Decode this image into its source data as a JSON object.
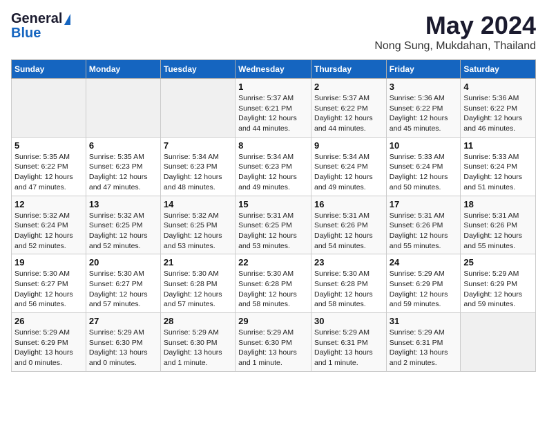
{
  "header": {
    "logo_line1": "General",
    "logo_line2": "Blue",
    "title": "May 2024",
    "subtitle": "Nong Sung, Mukdahan, Thailand"
  },
  "columns": [
    "Sunday",
    "Monday",
    "Tuesday",
    "Wednesday",
    "Thursday",
    "Friday",
    "Saturday"
  ],
  "weeks": [
    [
      {
        "day": "",
        "info": ""
      },
      {
        "day": "",
        "info": ""
      },
      {
        "day": "",
        "info": ""
      },
      {
        "day": "1",
        "info": "Sunrise: 5:37 AM\nSunset: 6:21 PM\nDaylight: 12 hours and 44 minutes."
      },
      {
        "day": "2",
        "info": "Sunrise: 5:37 AM\nSunset: 6:22 PM\nDaylight: 12 hours and 44 minutes."
      },
      {
        "day": "3",
        "info": "Sunrise: 5:36 AM\nSunset: 6:22 PM\nDaylight: 12 hours and 45 minutes."
      },
      {
        "day": "4",
        "info": "Sunrise: 5:36 AM\nSunset: 6:22 PM\nDaylight: 12 hours and 46 minutes."
      }
    ],
    [
      {
        "day": "5",
        "info": "Sunrise: 5:35 AM\nSunset: 6:22 PM\nDaylight: 12 hours and 47 minutes."
      },
      {
        "day": "6",
        "info": "Sunrise: 5:35 AM\nSunset: 6:23 PM\nDaylight: 12 hours and 47 minutes."
      },
      {
        "day": "7",
        "info": "Sunrise: 5:34 AM\nSunset: 6:23 PM\nDaylight: 12 hours and 48 minutes."
      },
      {
        "day": "8",
        "info": "Sunrise: 5:34 AM\nSunset: 6:23 PM\nDaylight: 12 hours and 49 minutes."
      },
      {
        "day": "9",
        "info": "Sunrise: 5:34 AM\nSunset: 6:24 PM\nDaylight: 12 hours and 49 minutes."
      },
      {
        "day": "10",
        "info": "Sunrise: 5:33 AM\nSunset: 6:24 PM\nDaylight: 12 hours and 50 minutes."
      },
      {
        "day": "11",
        "info": "Sunrise: 5:33 AM\nSunset: 6:24 PM\nDaylight: 12 hours and 51 minutes."
      }
    ],
    [
      {
        "day": "12",
        "info": "Sunrise: 5:32 AM\nSunset: 6:24 PM\nDaylight: 12 hours and 52 minutes."
      },
      {
        "day": "13",
        "info": "Sunrise: 5:32 AM\nSunset: 6:25 PM\nDaylight: 12 hours and 52 minutes."
      },
      {
        "day": "14",
        "info": "Sunrise: 5:32 AM\nSunset: 6:25 PM\nDaylight: 12 hours and 53 minutes."
      },
      {
        "day": "15",
        "info": "Sunrise: 5:31 AM\nSunset: 6:25 PM\nDaylight: 12 hours and 53 minutes."
      },
      {
        "day": "16",
        "info": "Sunrise: 5:31 AM\nSunset: 6:26 PM\nDaylight: 12 hours and 54 minutes."
      },
      {
        "day": "17",
        "info": "Sunrise: 5:31 AM\nSunset: 6:26 PM\nDaylight: 12 hours and 55 minutes."
      },
      {
        "day": "18",
        "info": "Sunrise: 5:31 AM\nSunset: 6:26 PM\nDaylight: 12 hours and 55 minutes."
      }
    ],
    [
      {
        "day": "19",
        "info": "Sunrise: 5:30 AM\nSunset: 6:27 PM\nDaylight: 12 hours and 56 minutes."
      },
      {
        "day": "20",
        "info": "Sunrise: 5:30 AM\nSunset: 6:27 PM\nDaylight: 12 hours and 57 minutes."
      },
      {
        "day": "21",
        "info": "Sunrise: 5:30 AM\nSunset: 6:28 PM\nDaylight: 12 hours and 57 minutes."
      },
      {
        "day": "22",
        "info": "Sunrise: 5:30 AM\nSunset: 6:28 PM\nDaylight: 12 hours and 58 minutes."
      },
      {
        "day": "23",
        "info": "Sunrise: 5:30 AM\nSunset: 6:28 PM\nDaylight: 12 hours and 58 minutes."
      },
      {
        "day": "24",
        "info": "Sunrise: 5:29 AM\nSunset: 6:29 PM\nDaylight: 12 hours and 59 minutes."
      },
      {
        "day": "25",
        "info": "Sunrise: 5:29 AM\nSunset: 6:29 PM\nDaylight: 12 hours and 59 minutes."
      }
    ],
    [
      {
        "day": "26",
        "info": "Sunrise: 5:29 AM\nSunset: 6:29 PM\nDaylight: 13 hours and 0 minutes."
      },
      {
        "day": "27",
        "info": "Sunrise: 5:29 AM\nSunset: 6:30 PM\nDaylight: 13 hours and 0 minutes."
      },
      {
        "day": "28",
        "info": "Sunrise: 5:29 AM\nSunset: 6:30 PM\nDaylight: 13 hours and 1 minute."
      },
      {
        "day": "29",
        "info": "Sunrise: 5:29 AM\nSunset: 6:30 PM\nDaylight: 13 hours and 1 minute."
      },
      {
        "day": "30",
        "info": "Sunrise: 5:29 AM\nSunset: 6:31 PM\nDaylight: 13 hours and 1 minute."
      },
      {
        "day": "31",
        "info": "Sunrise: 5:29 AM\nSunset: 6:31 PM\nDaylight: 13 hours and 2 minutes."
      },
      {
        "day": "",
        "info": ""
      }
    ]
  ]
}
